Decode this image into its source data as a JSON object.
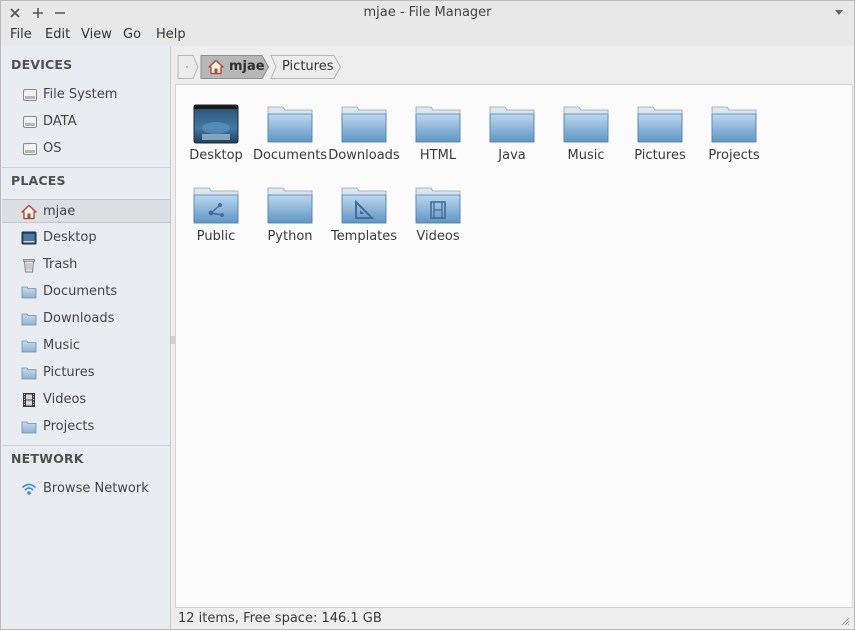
{
  "window": {
    "title": "mjae - File Manager"
  },
  "menubar": {
    "items": [
      "File",
      "Edit",
      "View",
      "Go",
      "Help"
    ]
  },
  "sidebar": {
    "devices_header": "DEVICES",
    "devices": [
      {
        "label": "File System",
        "icon": "drive-icon"
      },
      {
        "label": "DATA",
        "icon": "drive-icon"
      },
      {
        "label": "OS",
        "icon": "drive-icon"
      }
    ],
    "places_header": "PLACES",
    "places": [
      {
        "label": "mjae",
        "icon": "home-icon",
        "selected": true
      },
      {
        "label": "Desktop",
        "icon": "desktop-icon"
      },
      {
        "label": "Trash",
        "icon": "trash-icon"
      },
      {
        "label": "Documents",
        "icon": "folder-icon"
      },
      {
        "label": "Downloads",
        "icon": "folder-icon"
      },
      {
        "label": "Music",
        "icon": "folder-icon"
      },
      {
        "label": "Pictures",
        "icon": "folder-icon"
      },
      {
        "label": "Videos",
        "icon": "film-icon"
      },
      {
        "label": "Projects",
        "icon": "folder-icon"
      }
    ],
    "network_header": "NETWORK",
    "network": [
      {
        "label": "Browse Network",
        "icon": "wifi-icon"
      }
    ]
  },
  "pathbar": {
    "crumbs": [
      {
        "label": "mjae",
        "icon": "home-icon",
        "active": true
      },
      {
        "label": "Pictures",
        "active": false
      }
    ]
  },
  "files": [
    {
      "label": "Desktop",
      "icon": "desktop-folder-icon"
    },
    {
      "label": "Documents",
      "icon": "folder-icon"
    },
    {
      "label": "Downloads",
      "icon": "folder-icon"
    },
    {
      "label": "HTML",
      "icon": "folder-icon"
    },
    {
      "label": "Java",
      "icon": "folder-icon"
    },
    {
      "label": "Music",
      "icon": "folder-icon"
    },
    {
      "label": "Pictures",
      "icon": "folder-icon"
    },
    {
      "label": "Projects",
      "icon": "folder-icon"
    },
    {
      "label": "Public",
      "icon": "folder-public-icon"
    },
    {
      "label": "Python",
      "icon": "folder-icon"
    },
    {
      "label": "Templates",
      "icon": "folder-templates-icon"
    },
    {
      "label": "Videos",
      "icon": "folder-videos-icon"
    }
  ],
  "statusbar": {
    "text": "12 items, Free space: 146.1 GB"
  },
  "colors": {
    "folder_light": "#a9cbe8",
    "folder_dark": "#5f96c4",
    "selected_bg": "#dcdfe3",
    "sidebar_bg": "#e9ecf0",
    "content_bg": "#fbfbfb"
  }
}
